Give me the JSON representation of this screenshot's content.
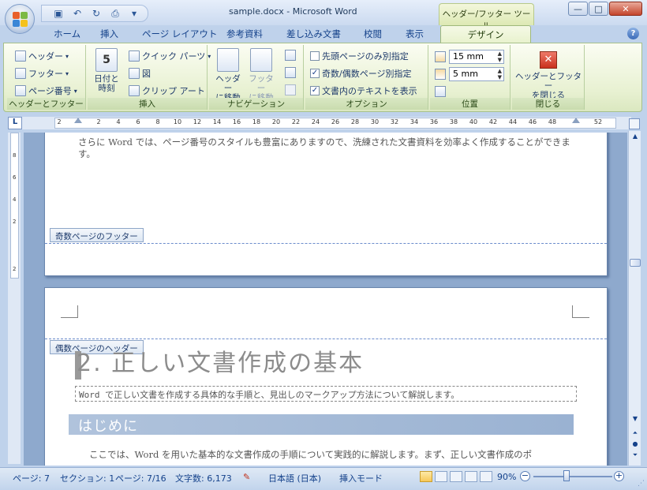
{
  "window": {
    "title": "sample.docx - Microsoft Word",
    "tool_tab_header": "ヘッダー/フッター ツール"
  },
  "qat": {
    "icons": [
      "save-icon",
      "undo-icon",
      "redo-icon",
      "print-icon",
      "customize-icon"
    ]
  },
  "tabs": [
    {
      "label": "ホーム"
    },
    {
      "label": "挿入"
    },
    {
      "label": "ページ レイアウト"
    },
    {
      "label": "参考資料"
    },
    {
      "label": "差し込み文書"
    },
    {
      "label": "校閲"
    },
    {
      "label": "表示"
    },
    {
      "label": "デザイン",
      "active": true
    }
  ],
  "ribbon": {
    "hf_group": {
      "label": "ヘッダーとフッター",
      "header": "ヘッダー",
      "footer": "フッター",
      "page_number": "ページ番号"
    },
    "insert_group": {
      "label": "挿入",
      "datetime_line1": "日付と",
      "datetime_line2": "時刻",
      "quick_parts": "クイック パーツ",
      "picture": "図",
      "clipart": "クリップ アート"
    },
    "nav_group": {
      "label": "ナビゲーション",
      "goto_header_1": "ヘッダー",
      "goto_header_2": "に移動",
      "goto_footer_1": "フッター",
      "goto_footer_2": "に移動"
    },
    "options_group": {
      "label": "オプション",
      "first_page": "先頭ページのみ別指定",
      "odd_even": "奇数/偶数ページ別指定",
      "show_text": "文書内のテキストを表示",
      "first_page_checked": false,
      "odd_even_checked": true,
      "show_text_checked": true
    },
    "position_group": {
      "label": "位置",
      "header_pos": "15 mm",
      "footer_pos": "5 mm"
    },
    "close_group": {
      "label": "閉じる",
      "close_line1": "ヘッダーとフッター",
      "close_line2": "を閉じる"
    }
  },
  "ruler": {
    "selector": "L",
    "ticks": [
      "2",
      "2",
      "4",
      "6",
      "8",
      "10",
      "12",
      "14",
      "16",
      "18",
      "20",
      "22",
      "24",
      "26",
      "28",
      "30",
      "32",
      "34",
      "36",
      "38",
      "40",
      "42",
      "44",
      "46",
      "48",
      "52"
    ]
  },
  "vruler": {
    "ticks": [
      "8",
      "6",
      "4",
      "2",
      "2"
    ]
  },
  "document": {
    "page1_text": "さらに Word では、ページ番号のスタイルも豊富にありますので、洗練された文書資料を効率よく作成することができます。",
    "odd_footer_label": "奇数ページのフッター",
    "even_header_label": "偶数ページのヘッダー",
    "heading": "2. 正しい文書作成の基本",
    "subtitle": "Word で正しい文書を作成する具体的な手順と、見出しのマークアップ方法について解説します。",
    "section_heading": "はじめに",
    "body_text": "ここでは、Word を用いた基本的な文書作成の手順について実践的に解説します。まず、正しい文書作成のポ"
  },
  "status": {
    "page": "ページ: 7",
    "section": "セクション: 1",
    "page_of": "ページ: 7/16",
    "words": "文字数: 6,173",
    "language": "日本語 (日本)",
    "mode": "挿入モード",
    "zoom": "90%",
    "zoom_minus": "−",
    "zoom_plus": "+"
  }
}
